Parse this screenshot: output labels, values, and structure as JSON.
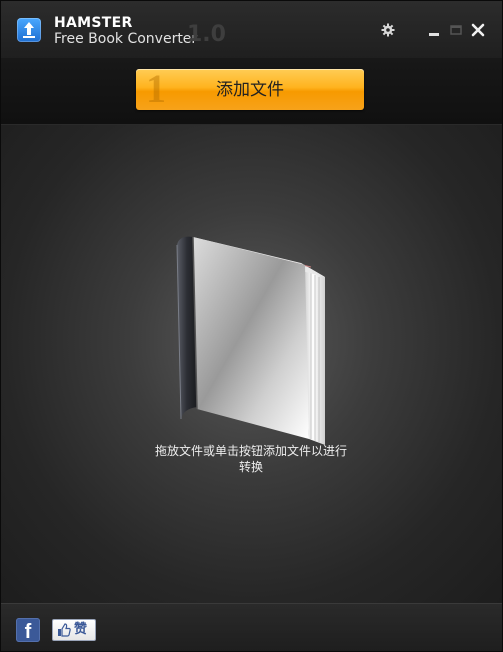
{
  "window": {
    "app_name": "HAMSTER",
    "app_subtitle": "Free Book Converter",
    "version": "1.0"
  },
  "titlebar_icons": {
    "settings": "gear-icon",
    "minimize": "minimize-icon",
    "restore": "restore-icon",
    "close": "close-icon"
  },
  "toolbar": {
    "step_number": "1",
    "add_files_label": "添加文件"
  },
  "drop_area": {
    "hint_line1": "拖放文件或单击按钮添加文件以进行",
    "hint_line2": "转换"
  },
  "footer": {
    "facebook_letter": "f",
    "like_label": "赞"
  },
  "colors": {
    "accent_orange": "#ffb31e",
    "background_dark": "#222222",
    "facebook_blue": "#3b5998"
  }
}
